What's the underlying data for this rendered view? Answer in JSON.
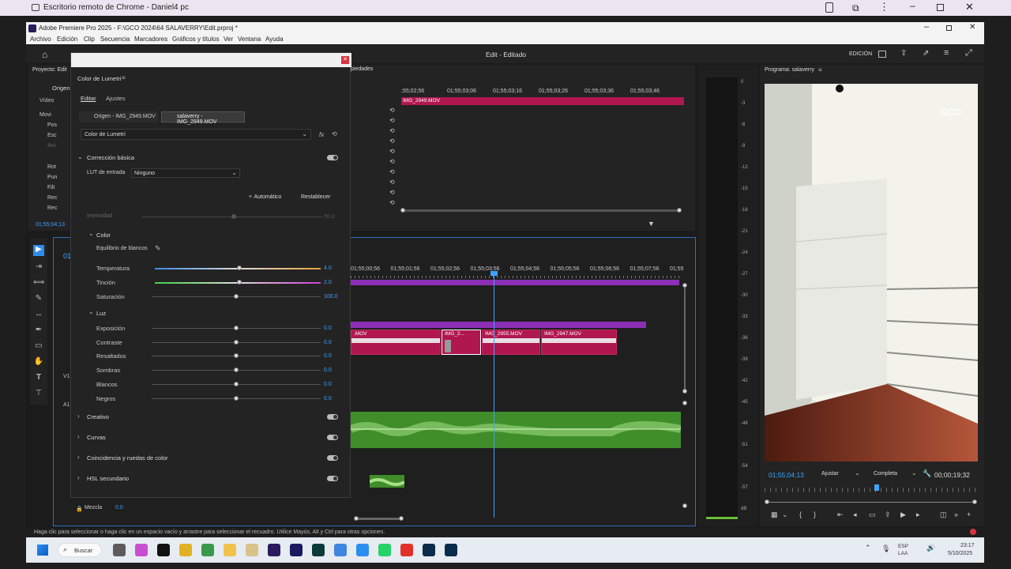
{
  "crd": {
    "title": "Escritorio remoto de Chrome - Daniel4 pc"
  },
  "premiere": {
    "title": "Adobe Premiere Pro 2025 - F:\\GCO 2024\\64 SALAVERRY\\Edit.prproj *",
    "menu": [
      "Archivo",
      "Edición",
      "Clip",
      "Secuencia",
      "Marcadores",
      "Gráficos y títulos",
      "Ver",
      "Ventana",
      "Ayuda"
    ],
    "workspace": "Edit - Editado",
    "edicion": "EDICIÓN"
  },
  "project": {
    "label": "Proyecto: Edit",
    "tab": "Origen",
    "video": "Vídeo",
    "items": [
      "Movi",
      "Pos",
      "Esc",
      "Ani",
      "Rot",
      "Pun",
      "Filt",
      "Rec",
      "Rec"
    ],
    "timecode": "01;55;04;13"
  },
  "source_header": "piedades",
  "source_timeline": {
    "ticks": [
      ";55;02;56",
      "01;55;03;06",
      "01;55;03;16",
      "01;55;03;26",
      "01;55;03;36",
      "01;55;03;46"
    ],
    "clip": "IMG_2949.MOV"
  },
  "lumetri": {
    "title": "Color de Lumetri",
    "tabs": {
      "edit": "Editar",
      "settings": "Ajustes"
    },
    "source_chip": "Origen - IMG_2949.MOV",
    "target_chip": "salaverry - IMG_2949.MOV",
    "effect_select": "Color de Lumetri",
    "basic": "Corrección básica",
    "lut_label": "LUT de entrada",
    "lut_value": "Ninguno",
    "auto": "Automático",
    "reset": "Restablecer",
    "intensity": "Intensidad",
    "intensity_val": "50.0",
    "color_section": "Color",
    "white_balance": "Equilibrio de blancos",
    "color_rows": [
      {
        "label": "Temperatura",
        "value": "4.0"
      },
      {
        "label": "Tinción",
        "value": "2.0"
      },
      {
        "label": "Saturación",
        "value": "100.0"
      }
    ],
    "light_section": "Luz",
    "light_rows": [
      {
        "label": "Exposición",
        "value": "0.0"
      },
      {
        "label": "Contraste",
        "value": "0.0"
      },
      {
        "label": "Resaltados",
        "value": "0.0"
      },
      {
        "label": "Sombras",
        "value": "0.0"
      },
      {
        "label": "Blancos",
        "value": "0.0"
      },
      {
        "label": "Negros",
        "value": "0.0"
      }
    ],
    "sections": [
      "Creativo",
      "Curvas",
      "Coincidencia y ruedas de color",
      "HSL secundario"
    ],
    "mix_label": "Mezcla",
    "mix_value": "0.0"
  },
  "timeline": {
    "ticks": [
      "01;55;00;56",
      "01;55;01;56",
      "01;55;02;56",
      "01;55;03;56",
      "01;55;04;56",
      "01;55;05;56",
      "01;55;06;56",
      "01;55;07;56",
      "01;55"
    ],
    "clips": [
      ".MOV",
      "IMG_2...",
      "IMG_2955.MOV",
      "IMG_2947.MOV"
    ],
    "v1": "V1",
    "a1": "A1",
    "tc": "01"
  },
  "meter": {
    "scale": [
      "0",
      "-3",
      "-6",
      "-9",
      "-12",
      "-15",
      "-18",
      "-21",
      "-24",
      "-27",
      "-30",
      "-33",
      "-36",
      "-39",
      "-42",
      "-45",
      "-48",
      "-51",
      "-54",
      "-57",
      "dB"
    ]
  },
  "program": {
    "label": "Programa: salaverry",
    "watermark": "GCO",
    "timecode": "01;55;04;13",
    "fit": "Ajustar",
    "quality": "Completa",
    "duration": "00;00;19;32"
  },
  "status": "Haga clic para seleccionar o haga clic en un espacio vacío y arrastre para seleccionar el recuadro. Utilice Mayús, Alt y Ctrl para otras opciones.",
  "taskbar": {
    "search": "Buscar",
    "lang1": "ESP",
    "lang2": "LAA",
    "time": "23:17",
    "date": "5/10/2025"
  },
  "colors": {
    "accent": "#2d8ceb",
    "clip": "#b0174f",
    "audio": "#3f8e2a",
    "purple": "#8c2fb6"
  }
}
